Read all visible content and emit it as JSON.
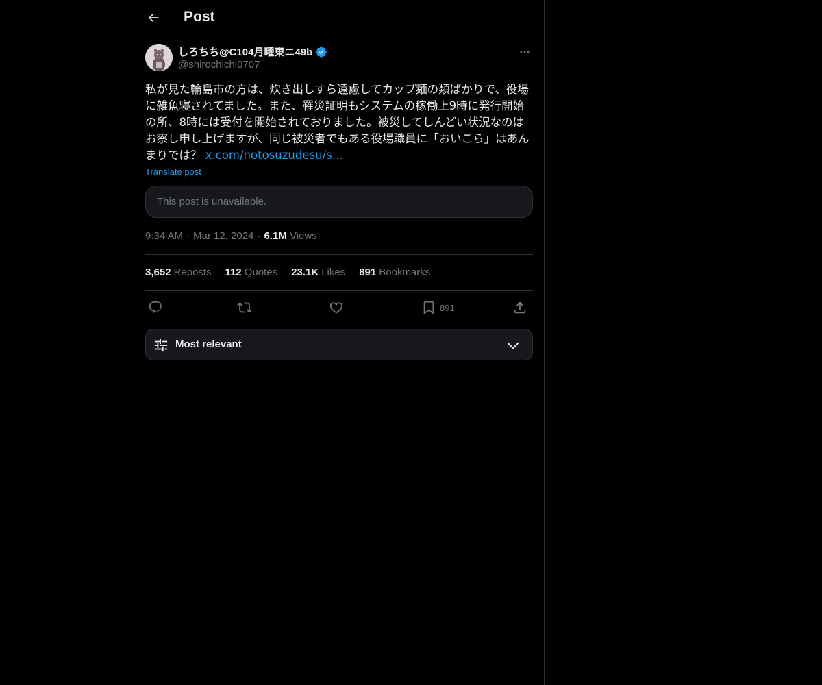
{
  "header": {
    "title": "Post",
    "back_icon": "arrow-left-icon"
  },
  "author": {
    "display_name": "しろちち@C104月曜東ニ49b",
    "handle": "@shirochichi0707",
    "verified": true,
    "verified_color": "#1d9bf0"
  },
  "post": {
    "text": "私が見た輪島市の方は、炊き出しすら遠慮してカップ麺の類ばかりで、役場に雑魚寝されてました。また、罹災証明もシステムの稼働上9時に発行開始の所、8時には受付を開始されておりました。被災してしんどい状況なのはお察し申し上げますが、同じ被災者でもある役場職員に「おいこら」はあんまりでは？ ",
    "link_text": "x.com/notosuzudesu/s…",
    "translate_label": "Translate post",
    "quoted_unavailable": "This post is unavailable.",
    "time": "9:34 AM",
    "date": "Mar 12, 2024",
    "views_count": "6.1M",
    "views_label": "Views"
  },
  "stats": {
    "reposts_count": "3,652",
    "reposts_label": "Reposts",
    "quotes_count": "112",
    "quotes_label": "Quotes",
    "likes_count": "23.1K",
    "likes_label": "Likes",
    "bookmarks_count": "891",
    "bookmarks_label": "Bookmarks"
  },
  "actions": {
    "bookmark_count": "891"
  },
  "sort": {
    "label": "Most relevant"
  },
  "colors": {
    "background": "#000000",
    "text": "#e7e9ea",
    "muted": "#71767b",
    "accent": "#1d9bf0",
    "border": "#2f3336"
  }
}
